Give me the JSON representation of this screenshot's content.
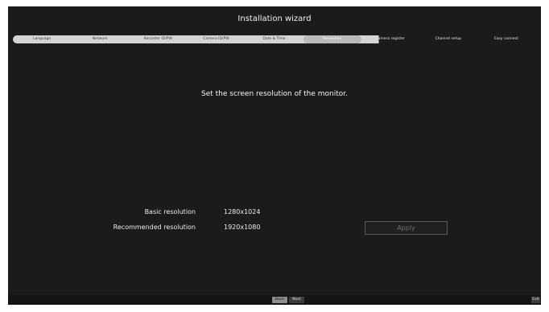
{
  "wizard": {
    "title": "Installation wizard"
  },
  "steps": [
    {
      "label": "Language",
      "state": "done"
    },
    {
      "label": "Network",
      "state": "done"
    },
    {
      "label": "Recorder ID/PW",
      "state": "done"
    },
    {
      "label": "Camera ID/PW",
      "state": "done"
    },
    {
      "label": "Date & Time",
      "state": "done"
    },
    {
      "label": "Resolution",
      "state": "active"
    },
    {
      "label": "Camera register",
      "state": "future"
    },
    {
      "label": "Channel setup",
      "state": "future"
    },
    {
      "label": "Easy connect",
      "state": "future"
    }
  ],
  "content": {
    "instruction": "Set the screen resolution of the monitor.",
    "basic_label": "Basic resolution",
    "basic_value": "1280x1024",
    "recommended_label": "Recommended resolution",
    "recommended_value": "1920x1080",
    "apply_label": "Apply"
  },
  "footer": {
    "back_label": "Back",
    "next_label": "Next",
    "exit_label": "Exit"
  },
  "colors": {
    "background": "#1b1b1b",
    "progress_done": "#d4d4d4",
    "progress_active": "#b9b9b9"
  }
}
